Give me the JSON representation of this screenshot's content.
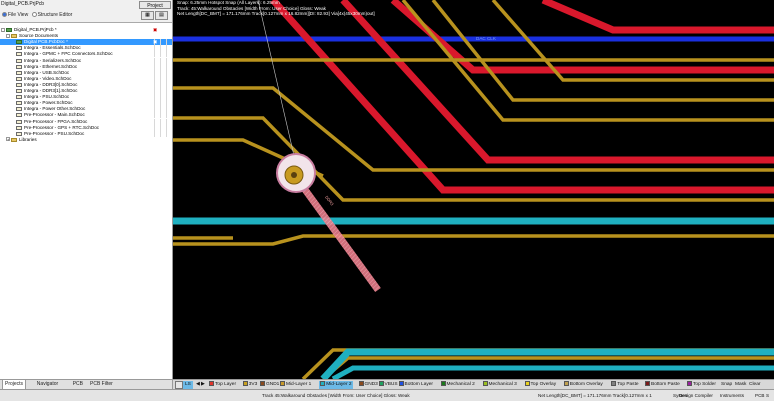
{
  "panel": {
    "title": "Digital_PCB.PrjPcb",
    "project_button": "Project",
    "view_label": "File View",
    "structure_label": "Structure Editor"
  },
  "tree": [
    {
      "level": 0,
      "icon": "pcb",
      "expand": "-",
      "text": "Digital_PCB.PrjPcb *",
      "mark": "",
      "selected": false
    },
    {
      "level": 1,
      "icon": "fold",
      "expand": "-",
      "text": "Source Documents",
      "mark": "",
      "selected": false
    },
    {
      "level": 2,
      "icon": "pcb",
      "expand": "",
      "text": "Digital PCB.PcbDoc *",
      "mark": "",
      "selected": true
    },
    {
      "level": 2,
      "icon": "doc",
      "expand": "",
      "text": "Integra - Essentials.SchDoc",
      "mark": "",
      "selected": false
    },
    {
      "level": 2,
      "icon": "doc",
      "expand": "",
      "text": "Integra - GPMC + FPC Connectors.SchDoc",
      "mark": "",
      "selected": false
    },
    {
      "level": 2,
      "icon": "doc",
      "expand": "",
      "text": "Integra - Serializers.SchDoc",
      "mark": "",
      "selected": false
    },
    {
      "level": 2,
      "icon": "doc",
      "expand": "",
      "text": "Integra - Ethernet.SchDoc",
      "mark": "",
      "selected": false
    },
    {
      "level": 2,
      "icon": "doc",
      "expand": "",
      "text": "Integra - USB.SchDoc",
      "mark": "",
      "selected": false
    },
    {
      "level": 2,
      "icon": "doc",
      "expand": "",
      "text": "Integra - Video.SchDoc",
      "mark": "",
      "selected": false
    },
    {
      "level": 2,
      "icon": "doc",
      "expand": "",
      "text": "Integra - DDR3[0].SchDoc",
      "mark": "",
      "selected": false
    },
    {
      "level": 2,
      "icon": "doc",
      "expand": "",
      "text": "Integra - DDR3[1].SchDoc",
      "mark": "",
      "selected": false
    },
    {
      "level": 2,
      "icon": "doc",
      "expand": "",
      "text": "Integra - PSU.SchDoc",
      "mark": "",
      "selected": false
    },
    {
      "level": 2,
      "icon": "doc",
      "expand": "",
      "text": "Integra - Power.SchDoc",
      "mark": "",
      "selected": false
    },
    {
      "level": 2,
      "icon": "doc",
      "expand": "",
      "text": "Integra - Power Other.SchDoc",
      "mark": "",
      "selected": false
    },
    {
      "level": 2,
      "icon": "doc",
      "expand": "",
      "text": "Pre-Processor - Main.SchDoc",
      "mark": "",
      "selected": false
    },
    {
      "level": 2,
      "icon": "doc",
      "expand": "",
      "text": "Pre-Processor - FPGA.SchDoc",
      "mark": "",
      "selected": false
    },
    {
      "level": 2,
      "icon": "doc",
      "expand": "",
      "text": "Pre-Processor - GPS + RTC.SchDoc",
      "mark": "",
      "selected": false
    },
    {
      "level": 2,
      "icon": "doc",
      "expand": "",
      "text": "Pre-Processor - PSU.SchDoc",
      "mark": "",
      "selected": false
    },
    {
      "level": 1,
      "icon": "fold",
      "expand": "+",
      "text": "Libraries",
      "mark": "",
      "selected": false
    }
  ],
  "left_tabs": [
    "Projects",
    "Navigator",
    "PCB",
    "PCB Filter"
  ],
  "hud": {
    "line1": "Snap: 6.25mm Hotspot Snap (All Layers): 6.25mm",
    "line2": "Track: 45:Walkaround Obstacles [Width From: User Choice] Gloss: Weak",
    "line3": "Net Length[DC_BMT] = 171.176mm Track[0.127mm x 16.82mm][DI: 82.93] Via[4x(45x30mm)out]"
  },
  "net_label": "DAC CLK",
  "diag_label": "DDR3",
  "layers": [
    {
      "name": "LS",
      "color": "#6cb9e6",
      "active": true
    },
    {
      "name": "Top Layer",
      "color": "#e0352b",
      "active": false
    },
    {
      "name": "3V3",
      "color": "#c8a020",
      "active": false
    },
    {
      "name": "GND1",
      "color": "#8a4a1e",
      "active": false
    },
    {
      "name": "Mid-Layer 1",
      "color": "#c89a2a",
      "active": false
    },
    {
      "name": "Mid-Layer 2",
      "color": "#20b0c0",
      "active": true
    },
    {
      "name": "GND3",
      "color": "#8a4a1e",
      "active": false
    },
    {
      "name": "VBUS",
      "color": "#20a060",
      "active": false
    },
    {
      "name": "Bottom Layer",
      "color": "#2050e0",
      "active": false
    },
    {
      "name": "Mechanical 2",
      "color": "#1a7a1a",
      "active": false
    },
    {
      "name": "Mechanical 3",
      "color": "#9ac020",
      "active": false
    },
    {
      "name": "Top Overlay",
      "color": "#e8d020",
      "active": false
    },
    {
      "name": "Bottom Overlay",
      "color": "#c0a050",
      "active": false
    },
    {
      "name": "Top Paste",
      "color": "#808080",
      "active": false
    },
    {
      "name": "Bottom Paste",
      "color": "#7a1a1a",
      "active": false
    },
    {
      "name": "Top Solder",
      "color": "#9a20a0",
      "active": false
    }
  ],
  "layer_right": [
    "Snap",
    "Mask",
    "Clear"
  ],
  "status": {
    "left": "Track 45:Walkaround Obstacles [Width From: User Choice] Gloss: Weak",
    "mid": "Net Length[DC_BMT] = 171.176mm Track[0.127mm x 1",
    "items": [
      "System",
      "Design Compiler",
      "Instruments",
      "PCB",
      "S"
    ]
  }
}
